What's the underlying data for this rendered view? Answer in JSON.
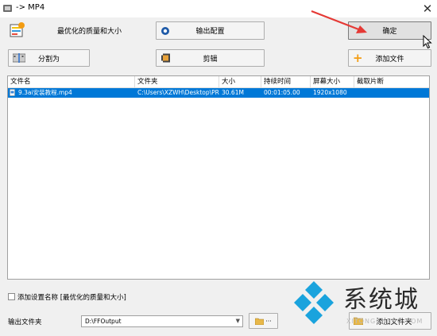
{
  "window": {
    "title": "-> MP4",
    "close_glyph": "✕"
  },
  "top_left": {
    "quality_label": "最优化的质量和大小",
    "icon": "quality-settings-icon"
  },
  "buttons": {
    "output_config": "输出配置",
    "ok": "确定",
    "split": "分割为",
    "clip": "剪辑",
    "add_file": "添加文件",
    "add_folder": "添加文件夹"
  },
  "file_table": {
    "columns": [
      "文件名",
      "文件夹",
      "大小",
      "持续时间",
      "屏幕大小",
      "截取片断"
    ],
    "rows": [
      {
        "name": "9.3ai安装教程.mp4",
        "folder": "C:\\Users\\XZWH\\Desktop\\PR...",
        "size": "30.61M",
        "duration": "00:01:05.00",
        "screen": "1920x1080",
        "clip": ""
      }
    ]
  },
  "options": {
    "add_setting_name_label": "添加设置名称 [最优化的质量和大小]",
    "add_setting_name_checked": false
  },
  "output": {
    "label": "输出文件夹",
    "path": "D:\\FFOutput",
    "more": "···"
  },
  "watermark": {
    "text": "系统城",
    "sub": "XITONGCHENG.COM"
  },
  "colors": {
    "selection": "#0078d7",
    "add_icon": "#f39c12",
    "arrow": "#e53935"
  }
}
